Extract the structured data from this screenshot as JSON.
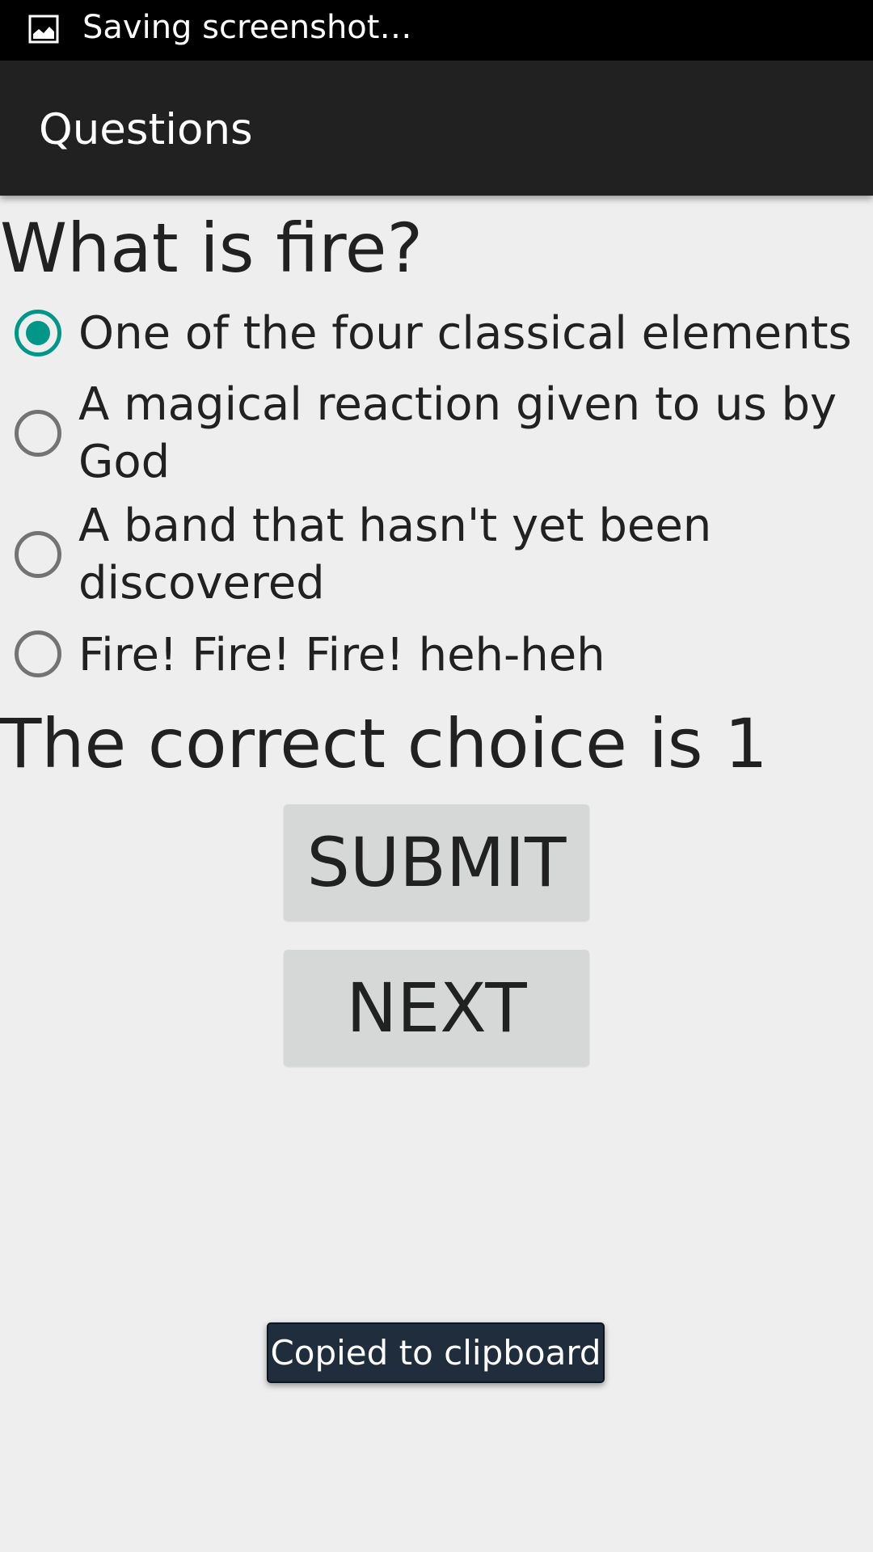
{
  "status_bar": {
    "notification_icon": "image-icon",
    "text": "Saving screenshot…"
  },
  "action_bar": {
    "title": "Questions"
  },
  "quiz": {
    "question": "What is fire?",
    "options": [
      {
        "label": "One of the four classical elements",
        "checked": true
      },
      {
        "label": "A magical reaction given to us by God",
        "checked": false
      },
      {
        "label": "A band that hasn't yet been discovered",
        "checked": false
      },
      {
        "label": "Fire! Fire! Fire! heh-heh",
        "checked": false
      }
    ],
    "answer_text": "The correct choice is 1",
    "submit_label": "SUBMIT",
    "next_label": "NEXT"
  },
  "toast": {
    "text": "Copied to clipboard"
  },
  "colors": {
    "accent": "#009688",
    "action_bar": "#212121",
    "background": "#eeeeee",
    "button": "#d6d7d7",
    "toast": "#1f2d3d"
  }
}
